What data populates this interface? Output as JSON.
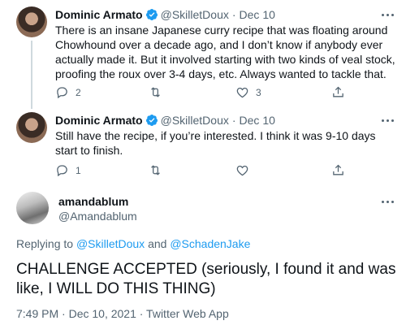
{
  "tweets": [
    {
      "name": "Dominic Armato",
      "handle": "@SkilletDoux",
      "separator": "·",
      "date": "Dec 10",
      "text": "There is an insane Japanese curry recipe that was floating around Chowhound over a decade ago, and I don’t know if anybody ever actually made it. But it involved starting with two kinds of veal stock, proofing the roux over 3-4 days, etc. Always wanted to tackle that.",
      "replies": "2",
      "retweets": "",
      "likes": "3"
    },
    {
      "name": "Dominic Armato",
      "handle": "@SkilletDoux",
      "separator": "·",
      "date": "Dec 10",
      "text": "Still have the recipe, if you’re interested. I think it was 9-10 days start to finish.",
      "replies": "1",
      "retweets": "",
      "likes": ""
    }
  ],
  "main_tweet": {
    "name": "amandablum",
    "handle": "@Amandablum",
    "replying_prefix": "Replying to",
    "mention_1": "@SkilletDoux",
    "and_word": "and",
    "mention_2": "@SchadenJake",
    "text": "CHALLENGE ACCEPTED (seriously, I found it and was like, I WILL DO THIS THING)",
    "timestamp": "7:49 PM · Dec 10, 2021 · Twitter Web App"
  },
  "icons": {
    "verified": "verified-badge-icon",
    "more": "more-options-icon",
    "reply": "reply-icon",
    "retweet": "retweet-icon",
    "like": "heart-icon",
    "share": "share-icon"
  },
  "colors": {
    "accent": "#1d9bf0",
    "secondary_text": "#536471",
    "primary_text": "#0f1419",
    "thread_line": "#cfd9de"
  }
}
